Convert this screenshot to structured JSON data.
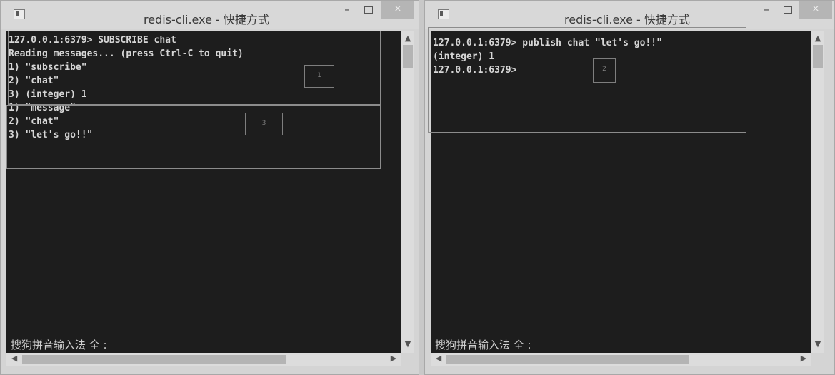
{
  "left_window": {
    "title": "redis-cli.exe - 快捷方式",
    "controls": {
      "minimize": "–",
      "close": "×"
    },
    "lines": [
      "127.0.0.1:6379> SUBSCRIBE chat",
      "Reading messages... (press Ctrl-C to quit)",
      "1) \"subscribe\"",
      "2) \"chat\"",
      "3) (integer) 1",
      "1) \"message\"",
      "2) \"chat\"",
      "3) \"let's go!!\""
    ],
    "ime_status": "搜狗拼音输入法 全 :",
    "markers": [
      "1",
      "3"
    ]
  },
  "right_window": {
    "title": "redis-cli.exe - 快捷方式",
    "controls": {
      "minimize": "–",
      "close": "×"
    },
    "lines": [
      "127.0.0.1:6379> publish chat \"let's go!!\"",
      "(integer) 1",
      "127.0.0.1:6379>"
    ],
    "ime_status": "搜狗拼音输入法 全 :",
    "markers": [
      "2"
    ]
  },
  "scroll_arrows": {
    "up": "▲",
    "down": "▼",
    "left": "◀",
    "right": "▶"
  }
}
